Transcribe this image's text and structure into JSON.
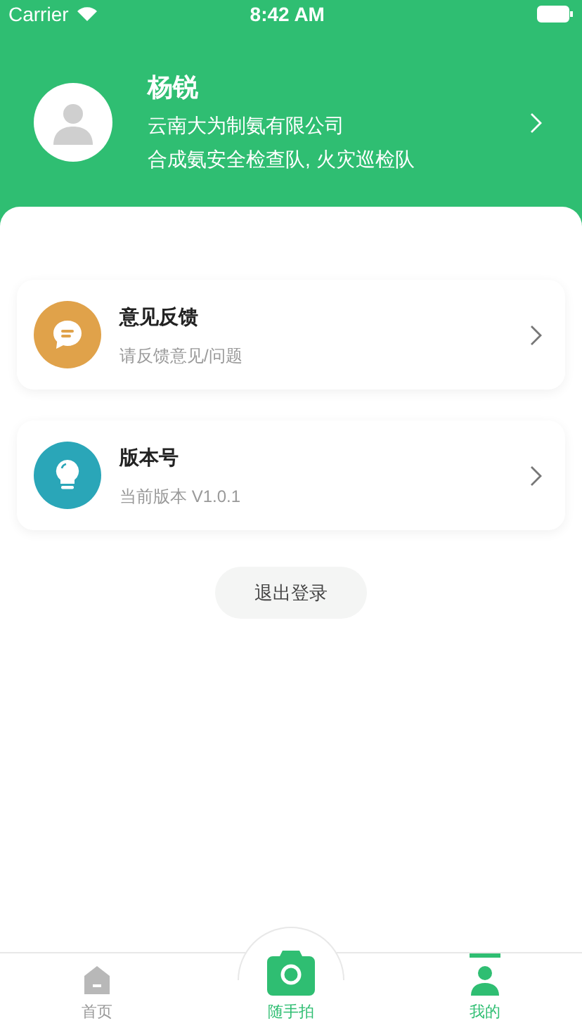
{
  "status_bar": {
    "carrier": "Carrier",
    "time": "8:42 AM"
  },
  "profile": {
    "name": "杨锐",
    "company": "云南大为制氨有限公司",
    "teams": "合成氨安全检查队, 火灾巡检队"
  },
  "menu": [
    {
      "kind": "feedback",
      "color": "#e0a24a",
      "title": "意见反馈",
      "subtitle": "请反馈意见/问题"
    },
    {
      "kind": "version",
      "color": "#2aa6b8",
      "title": "版本号",
      "subtitle": "当前版本 V1.0.1"
    }
  ],
  "logout": "退出登录",
  "tabs": [
    {
      "kind": "home",
      "label": "首页",
      "selected": false
    },
    {
      "kind": "camera",
      "label": "随手拍",
      "selected": false
    },
    {
      "kind": "me",
      "label": "我的",
      "selected": true
    }
  ]
}
